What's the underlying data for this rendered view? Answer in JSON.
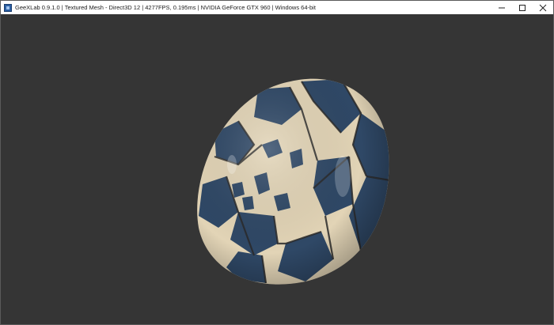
{
  "window": {
    "title": "GeeXLab 0.9.1.0 | Textured Mesh - Direct3D 12 | 4277FPS, 0.195ms | NVIDIA GeForce GTX 960 | Windows 64-bit",
    "icons": {
      "app": "app-icon",
      "minimize": "minimize-icon",
      "maximize": "maximize-icon",
      "close": "close-icon"
    }
  },
  "scene": {
    "background_color": "#353535",
    "object": "textured-torus",
    "tile_colors": {
      "dark": "#2f4866",
      "light": "#e2d4b6"
    }
  }
}
